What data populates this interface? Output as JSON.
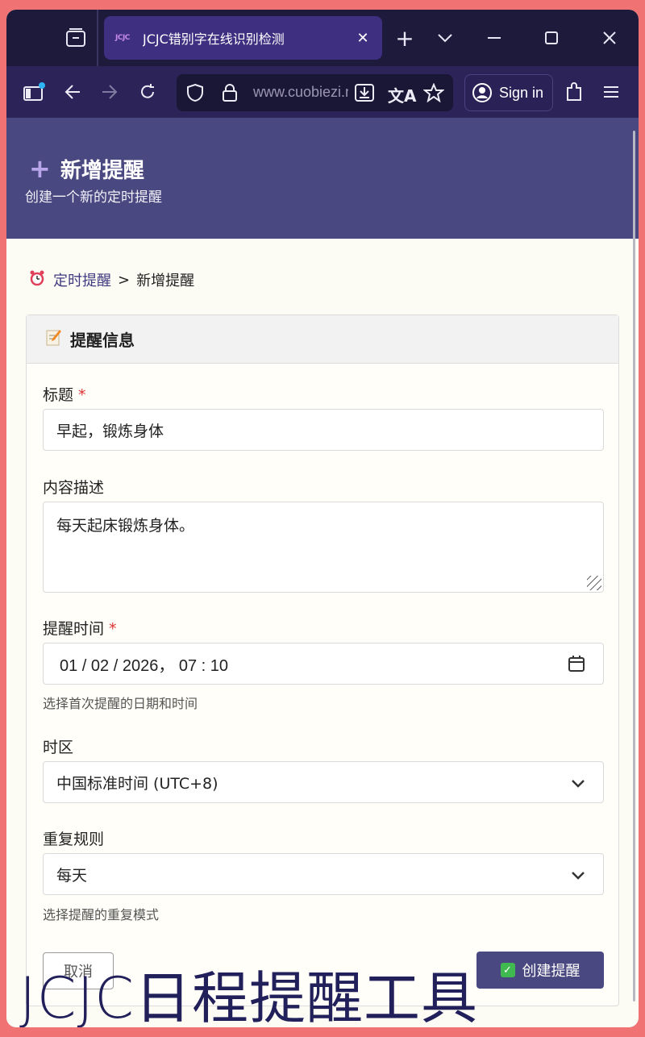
{
  "browser": {
    "tab_title": "JCJC错别字在线识别检测",
    "tab_favicon": "JCJC",
    "url": "www.cuobiezi.net",
    "sign_in_label": "Sign in"
  },
  "header": {
    "title": "新增提醒",
    "subtitle": "创建一个新的定时提醒"
  },
  "breadcrumb": {
    "parent": "定时提醒",
    "separator": ">",
    "current": "新增提醒"
  },
  "form": {
    "section_title": "提醒信息",
    "title_label": "标题",
    "required_mark": "*",
    "title_value": "早起，锻炼身体",
    "content_label": "内容描述",
    "content_value": "每天起床锻炼身体。",
    "time_label": "提醒时间",
    "time_value": "01 / 02 / 2026， 07 : 10",
    "time_help": "选择首次提醒的日期和时间",
    "timezone_label": "时区",
    "timezone_value": "中国标准时间 (UTC+8)",
    "repeat_label": "重复规则",
    "repeat_value": "每天",
    "repeat_help": "选择提醒的重复模式",
    "cancel_label": "取消",
    "create_label": "创建提醒"
  },
  "watermark": "JCJC日程提醒工具",
  "colors": {
    "header_bg": "#4a4880",
    "tab_active": "#3e2f80",
    "toolbar_bg": "#2c2459",
    "required": "#dd3333",
    "create_button": "#4a4880"
  }
}
